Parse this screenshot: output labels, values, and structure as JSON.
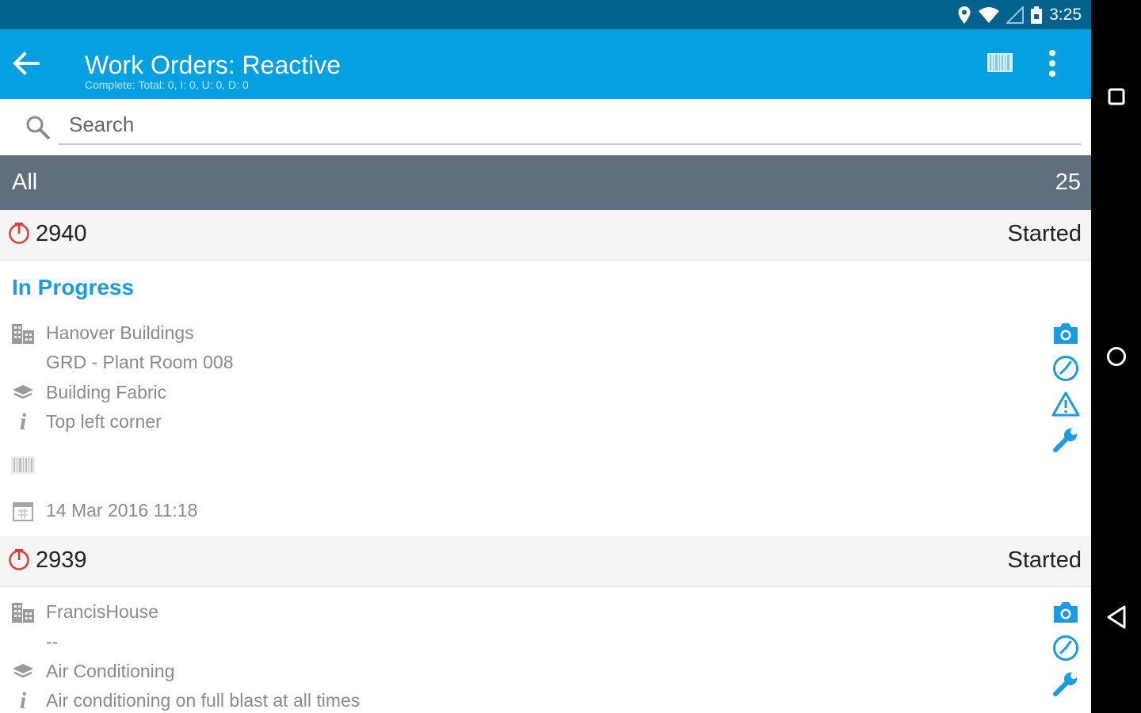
{
  "status_bar": {
    "time": "3:25"
  },
  "app_bar": {
    "title": "Work Orders: Reactive",
    "subtitle": "Complete: Total: 0, I: 0, U: 0, D: 0"
  },
  "search": {
    "placeholder": "Search",
    "value": ""
  },
  "group": {
    "name": "All",
    "count": "25"
  },
  "work_orders": [
    {
      "number": "2940",
      "status": "Started",
      "progress": "In Progress",
      "building": "Hanover Buildings",
      "location": "GRD - Plant Room 008",
      "category": "Building Fabric",
      "info": "Top left corner",
      "date": "14 Mar 2016 11:18"
    },
    {
      "number": "2939",
      "status": "Started",
      "building": "FrancisHouse",
      "location": "--",
      "category": "Air Conditioning",
      "info": "Air conditioning on full blast at all times"
    }
  ],
  "colors": {
    "status_bar": "#01628e",
    "app_bar": "#05a0e2",
    "group_header": "#616e7e",
    "accent": "#1b9be0",
    "timer": "#e53935"
  }
}
